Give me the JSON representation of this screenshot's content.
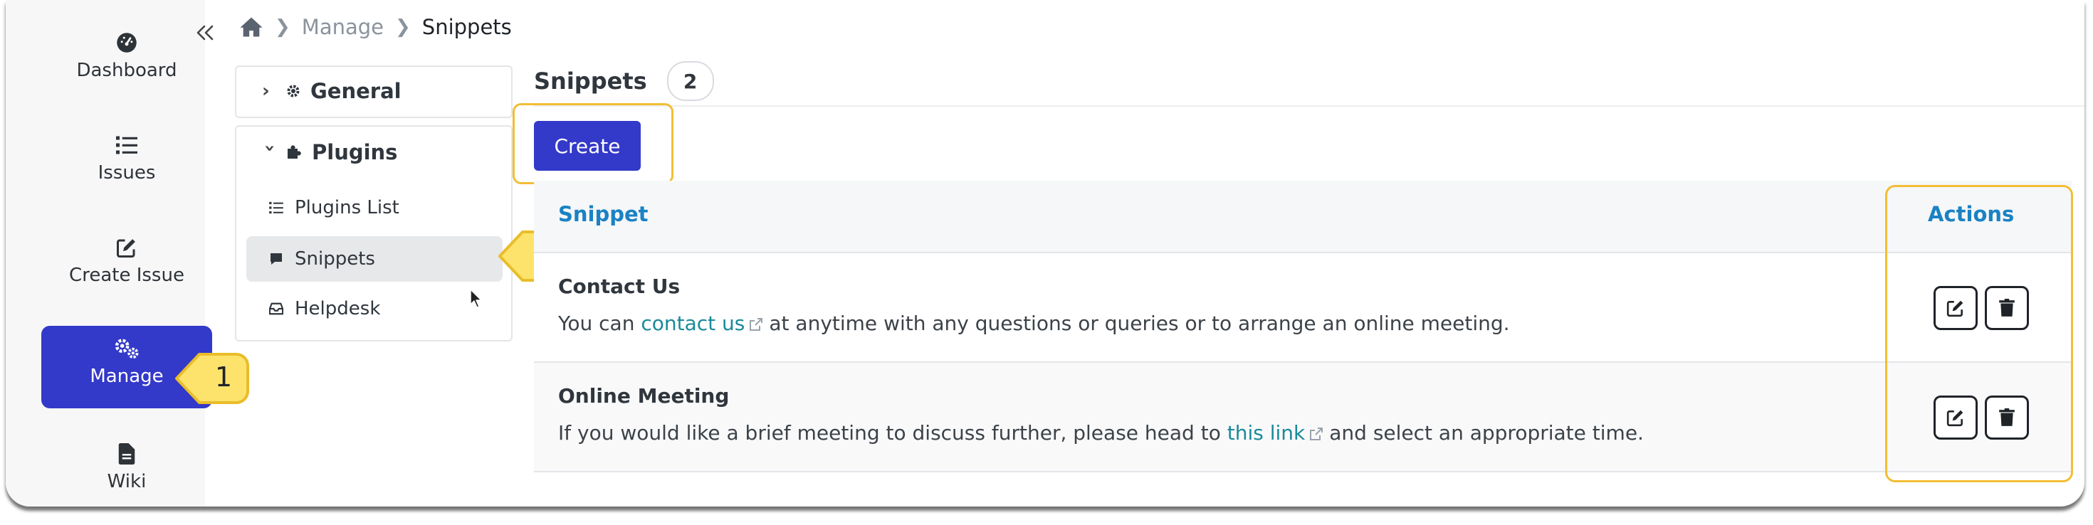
{
  "sidebar": {
    "items": [
      {
        "label": "Dashboard",
        "icon": "dashboard-icon"
      },
      {
        "label": "Issues",
        "icon": "list-icon"
      },
      {
        "label": "Create Issue",
        "icon": "edit-icon"
      },
      {
        "label": "Manage",
        "icon": "gears-icon",
        "active": true
      },
      {
        "label": "Wiki",
        "icon": "file-icon"
      }
    ],
    "collapse_icon": "double-chevron-left-icon"
  },
  "callouts": {
    "first": "1",
    "second": "2"
  },
  "breadcrumb": {
    "home_icon": "home-icon",
    "items": [
      "Manage",
      "Snippets"
    ]
  },
  "settings_tree": {
    "general": {
      "label": "General",
      "expanded": false
    },
    "plugins": {
      "label": "Plugins",
      "expanded": true,
      "items": [
        {
          "label": "Plugins List",
          "icon": "list-icon"
        },
        {
          "label": "Snippets",
          "icon": "comment-icon",
          "selected": true
        },
        {
          "label": "Helpdesk",
          "icon": "inbox-icon"
        }
      ]
    }
  },
  "main": {
    "title": "Snippets",
    "count": "2",
    "create_label": "Create",
    "table": {
      "columns": [
        "Snippet",
        "Actions"
      ],
      "rows": [
        {
          "title": "Contact Us",
          "desc_before": "You can",
          "link_text": "contact us",
          "desc_after": "at anytime with any questions or queries or to arrange an online meeting."
        },
        {
          "title": "Online Meeting",
          "desc_before": "If you would like a brief meeting to discuss further, please head to",
          "link_text": "this link",
          "desc_after": "and select an appropriate time."
        }
      ]
    }
  },
  "colors": {
    "accent": "#3339c8",
    "highlight": "#f3be35",
    "callout": "#fde36b",
    "link": "#1a8a9a",
    "header_text": "#1a82c4"
  }
}
